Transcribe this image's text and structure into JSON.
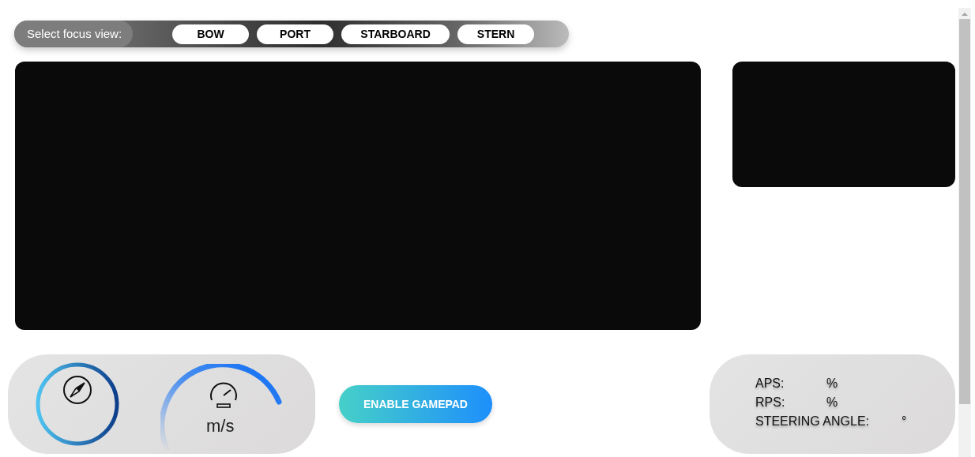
{
  "focus_bar": {
    "label": "Select focus view:",
    "views": [
      {
        "label": "BOW"
      },
      {
        "label": "PORT"
      },
      {
        "label": "STARBOARD"
      },
      {
        "label": "STERN"
      }
    ]
  },
  "speed": {
    "unit": "m/s"
  },
  "gamepad_button": {
    "label": "ENABLE GAMEPAD"
  },
  "telemetry": [
    {
      "label": "APS:",
      "unit": "%"
    },
    {
      "label": "RPS:",
      "unit": "%"
    },
    {
      "label": "STEERING ANGLE:",
      "unit": "°"
    }
  ]
}
